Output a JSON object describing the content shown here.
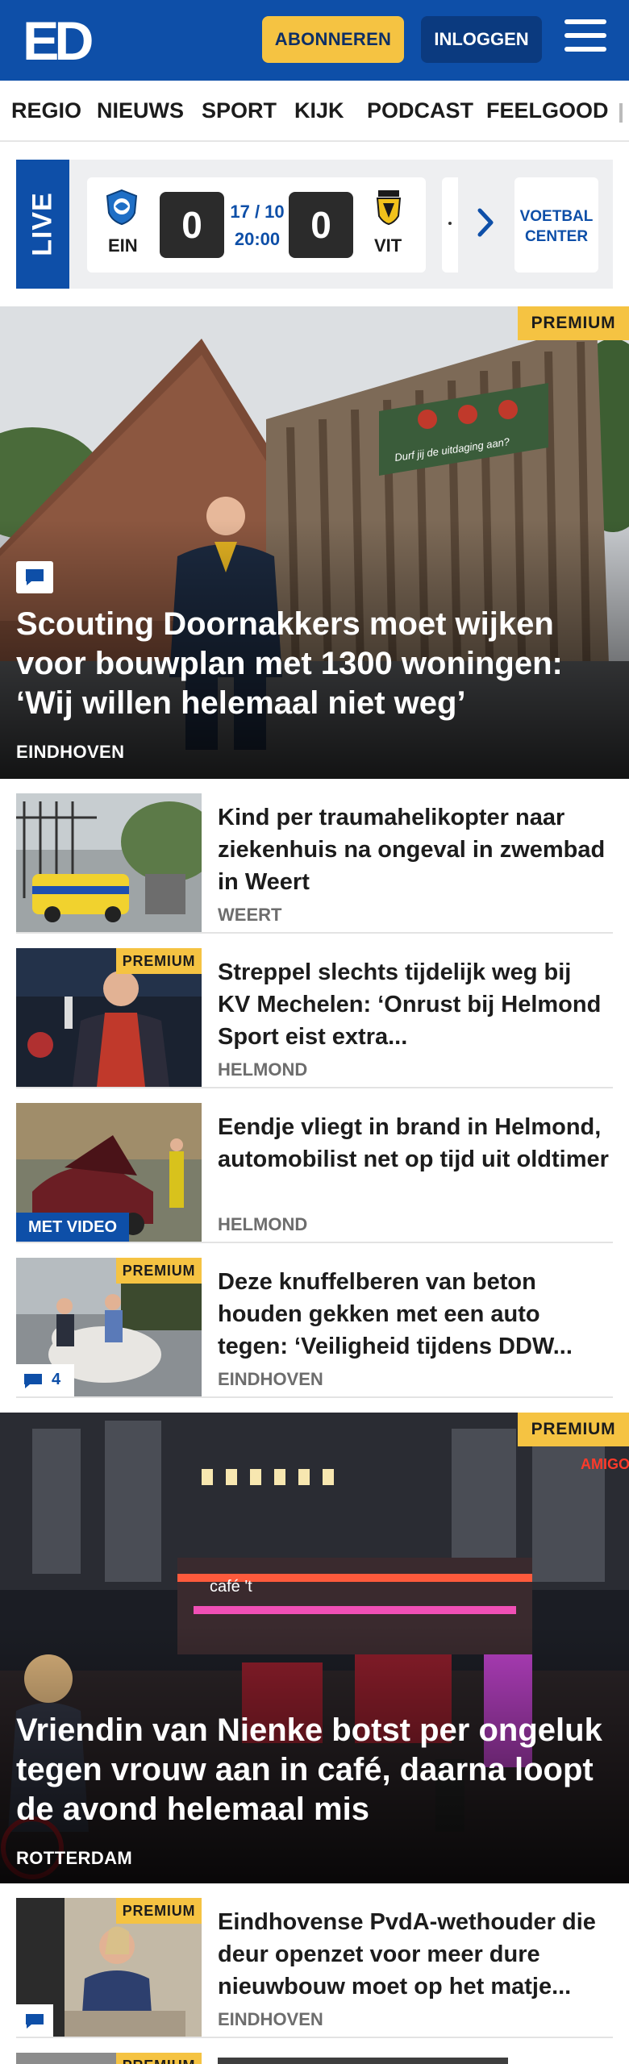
{
  "header": {
    "logo_text": "ED",
    "subscribe_label": "ABONNEREN",
    "login_label": "INLOGGEN",
    "brand_color": "#0e4fa8",
    "accent_color": "#f5c342"
  },
  "nav": {
    "items": [
      "REGIO",
      "NIEUWS",
      "SPORT",
      "KIJK",
      "PODCAST",
      "FEELGOOD"
    ]
  },
  "live": {
    "label": "LIVE",
    "match": {
      "home_code": "EIN",
      "away_code": "VIT",
      "home_score": "0",
      "away_score": "0",
      "date": "17 / 10",
      "time": "20:00"
    },
    "next_card_text": "-",
    "voetbal_center_line1": "VOETBAL",
    "voetbal_center_line2": "CENTER"
  },
  "hero1": {
    "badge": "PREMIUM",
    "title": "Scouting Doornakkers moet wijken voor bouwplan met 1300 woningen: ‘Wij willen helemaal niet weg’",
    "category": "EINDHOVEN",
    "sign_text": "Durf jij de uitdaging aan?"
  },
  "articles": [
    {
      "title": "Kind per traumahelikopter naar ziekenhuis na ongeval in zwembad in Weert",
      "category": "WEERT",
      "badge": "",
      "overlay": ""
    },
    {
      "title": "Streppel slechts tijdelijk weg bij KV Mechelen: ‘Onrust bij Helmond Sport eist extra...",
      "category": "HELMOND",
      "badge": "PREMIUM",
      "overlay": ""
    },
    {
      "title": "Eendje vliegt in brand in Helmond, automobilist net op tijd uit oldtimer",
      "category": "HELMOND",
      "badge": "",
      "overlay": "MET VIDEO"
    },
    {
      "title": "Deze knuffelberen van beton houden gekken met een auto tegen: ‘Veiligheid tijdens DDW...",
      "category": "EINDHOVEN",
      "badge": "PREMIUM",
      "comment_count": "4"
    }
  ],
  "hero2": {
    "badge": "PREMIUM",
    "title": "Vriendin van Nienke botst per ongeluk tegen vrouw aan in café, daarna loopt de avond helemaal mis",
    "category": "ROTTERDAM",
    "sign_text": "café 't",
    "sign_text_2": "AMIGO"
  },
  "article5": {
    "title": "Eindhovense PvdA-wethouder die deur openzet voor meer dure nieuwbouw moet op het matje...",
    "category": "EINDHOVEN",
    "badge": "PREMIUM"
  },
  "article6": {
    "badge": "PREMIUM"
  }
}
